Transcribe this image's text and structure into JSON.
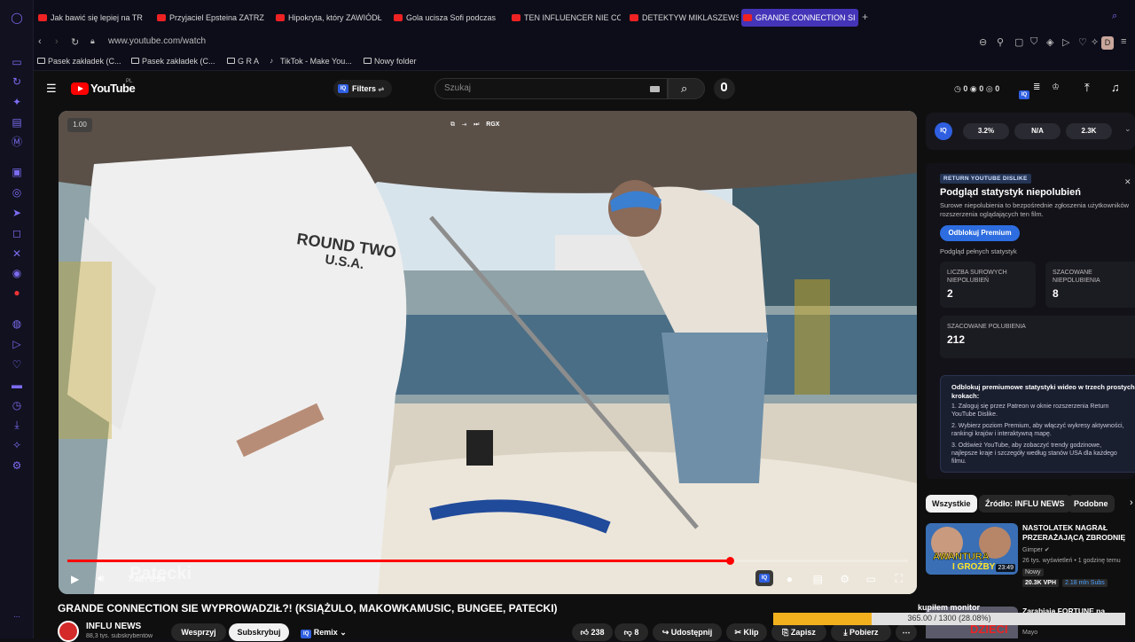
{
  "browser": {
    "tabs": [
      {
        "label": "Jak bawić się lepiej na TR"
      },
      {
        "label": "Przyjaciel Epsteina ZATRZ"
      },
      {
        "label": "Hipokryta, który ZAWIÓDŁ"
      },
      {
        "label": "Gola ucisza Sofi podczas"
      },
      {
        "label": "TEN INFLUENCER NIE CO"
      },
      {
        "label": "DETEKTYW MIKLASZEWS"
      },
      {
        "label": "GRANDE CONNECTION SI"
      }
    ],
    "url": "www.youtube.com/watch",
    "profile_initial": "D",
    "bookmarks": [
      {
        "label": "Pasek zakładek (C..."
      },
      {
        "label": "Pasek zakładek (C..."
      },
      {
        "label": "G R A"
      },
      {
        "label": "TikTok - Make You..."
      },
      {
        "label": "Nowy folder"
      }
    ]
  },
  "youtube": {
    "logo_text": "YouTube",
    "logo_region": "PL",
    "filters_label": "Filters",
    "search_placeholder": "Szukaj",
    "header_counts": [
      "0",
      "0",
      "0"
    ]
  },
  "player": {
    "speed": "1.00",
    "overlay_label": "RGX",
    "time": "7:48 / 9:54",
    "progress_fraction": 0.788,
    "watermark": "Patecki",
    "shirt_text_1": "ROUND TWO",
    "shirt_text_2": "U.S.A."
  },
  "video": {
    "title": "GRANDE CONNECTION SIE WYPROWADZIŁ?! (KSIĄŻULO, MAKOWKAMUSIC, BUNGEE, PATECKI)",
    "channel": "INFLU NEWS",
    "subs": "88,3 tys. subskrybentów",
    "support_label": "Wesprzyj",
    "subscribe_label": "Subskrybuj",
    "remix_label": "Remix",
    "likes": "238",
    "dislikes": "8",
    "share_label": "Udostępnij",
    "clip_label": "Klip",
    "save_label": "Zapisz",
    "download_label": "Pobierz"
  },
  "stats_bar": {
    "values": [
      "3.2%",
      "N/A",
      "2.3K"
    ]
  },
  "dislike_panel": {
    "badge": "RETURN YOUTUBE DISLIKE",
    "title": "Podgląd statystyk niepolubień",
    "description": "Surowe niepolubienia to bezpośrednie zgłoszenia użytkowników rozszerzenia oglądających ten film.",
    "unlock_button": "Odblokuj Premium",
    "preview_label": "Podgląd pełnych statystyk",
    "raw_dislikes_label": "LICZBA SUROWYCH NIEPOLUBIEŃ",
    "raw_dislikes_value": "2",
    "est_dislikes_label": "SZACOWANE NIEPOLUBIENIA",
    "est_dislikes_value": "8",
    "est_likes_label": "SZACOWANE POLUBIENIA",
    "est_likes_value": "212",
    "premium_title": "Odblokuj premiumowe statystyki wideo w trzech prostych krokach:",
    "steps": [
      "Zaloguj się przez Patreon w oknie rozszerzenia Return YouTube Dislike.",
      "Wybierz poziom Premium, aby włączyć wykresy aktywności, rankingi krajów i interaktywną mapę.",
      "Odśwież YouTube, aby zobaczyć trendy godzinowe, najlepsze kraje i szczegóły według stanów USA dla każdego filmu."
    ]
  },
  "related": {
    "chips": [
      "Wszystkie",
      "Źródło: INFLU NEWS",
      "Podobne"
    ],
    "items": [
      {
        "title": "NASTOLATEK NAGRAŁ PRZERAŻAJĄCĄ ZBRODNIĘ",
        "channel": "Gimper",
        "meta": "26 tys. wyświetleń • 1 godzinę temu",
        "badge": "Nowy",
        "vph": "20.3K VPH",
        "subs_ratio": "2.18 mln Subs",
        "duration": "23:49",
        "thumb_text_1": "AWANTURA",
        "thumb_text_2": "I GROŹBY"
      },
      {
        "title": "Zarabiają FORTUNE na",
        "channel": "Mayo",
        "thumb_text": "DZIECI"
      }
    ]
  },
  "download_overlay": {
    "label": "kupiłem monitor",
    "progress_text": "365.00 / 1300 (28.08%)",
    "fraction": 0.2808
  }
}
